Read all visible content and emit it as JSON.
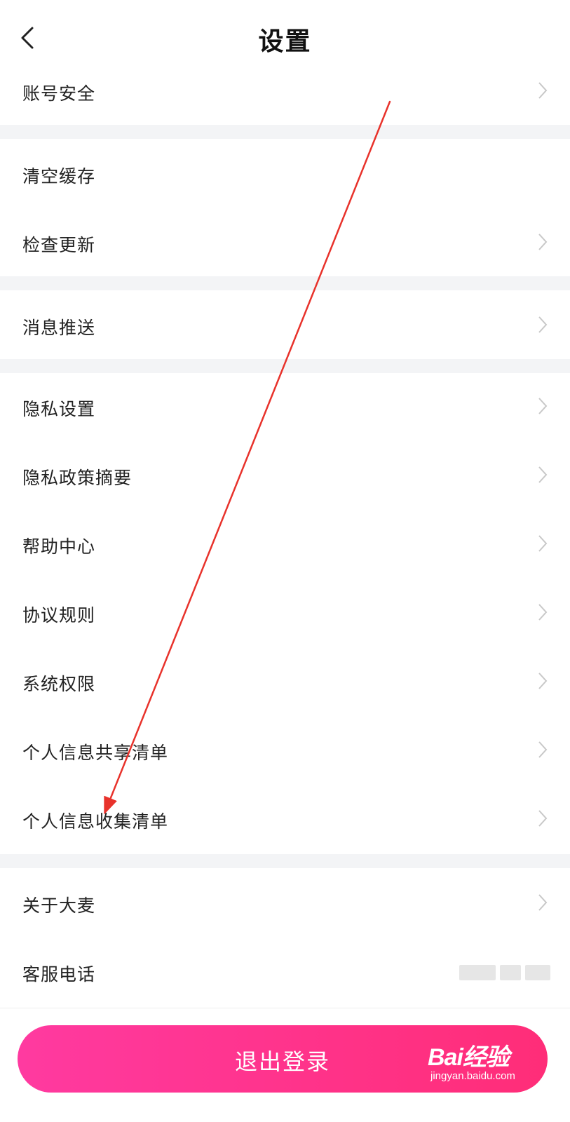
{
  "header": {
    "title": "设置",
    "back_icon": "chevron-left-icon"
  },
  "sections": [
    {
      "items": [
        {
          "label": "账号安全",
          "chevron": true
        }
      ]
    },
    {
      "items": [
        {
          "label": "清空缓存",
          "chevron": false
        },
        {
          "label": "检查更新",
          "chevron": true
        }
      ]
    },
    {
      "items": [
        {
          "label": "消息推送",
          "chevron": true
        }
      ]
    },
    {
      "items": [
        {
          "label": "隐私设置",
          "chevron": true
        },
        {
          "label": "隐私政策摘要",
          "chevron": true
        },
        {
          "label": "帮助中心",
          "chevron": true
        },
        {
          "label": "协议规则",
          "chevron": true
        },
        {
          "label": "系统权限",
          "chevron": true
        },
        {
          "label": "个人信息共享清单",
          "chevron": true
        },
        {
          "label": "个人信息收集清单",
          "chevron": true
        }
      ]
    },
    {
      "items": [
        {
          "label": "关于大麦",
          "chevron": true
        },
        {
          "label": "客服电话",
          "chevron": false
        }
      ]
    }
  ],
  "logout": {
    "label": "退出登录"
  },
  "watermark": {
    "logo": "Bai经验",
    "url": "jingyan.baidu.com"
  },
  "colors": {
    "accent_start": "#ff3aa0",
    "accent_end": "#ff2d78",
    "divider": "#f3f4f6",
    "annotation_arrow": "#e8322b"
  }
}
